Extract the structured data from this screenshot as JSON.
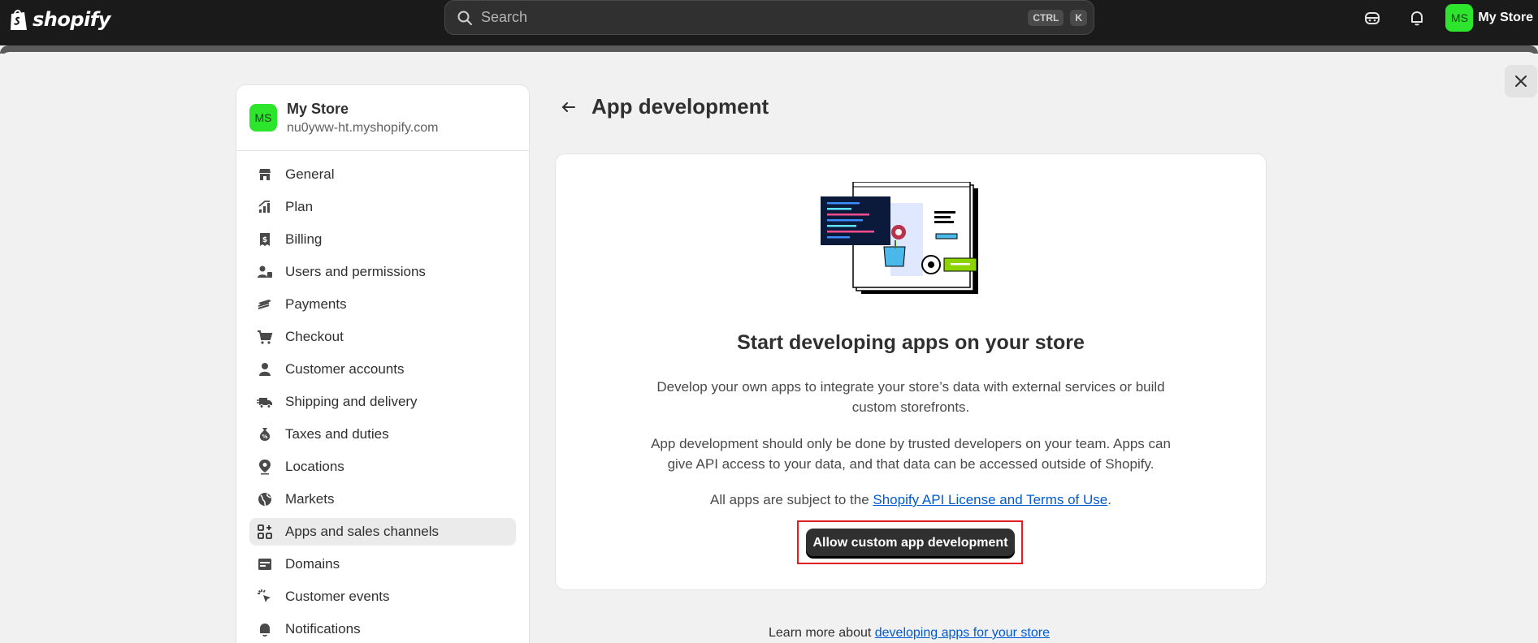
{
  "topbar": {
    "brand": "shopify",
    "search_placeholder": "Search",
    "shortcut_ctrl": "CTRL",
    "shortcut_key": "K",
    "store_initials": "MS",
    "store_name": "My Store"
  },
  "sidebar": {
    "store_initials": "MS",
    "store_name": "My Store",
    "store_domain": "nu0yww-ht.myshopify.com",
    "items": [
      {
        "label": "General",
        "icon": "store-icon",
        "active": false
      },
      {
        "label": "Plan",
        "icon": "plan-icon",
        "active": false
      },
      {
        "label": "Billing",
        "icon": "billing-icon",
        "active": false
      },
      {
        "label": "Users and permissions",
        "icon": "users-icon",
        "active": false
      },
      {
        "label": "Payments",
        "icon": "payments-icon",
        "active": false
      },
      {
        "label": "Checkout",
        "icon": "cart-icon",
        "active": false
      },
      {
        "label": "Customer accounts",
        "icon": "person-icon",
        "active": false
      },
      {
        "label": "Shipping and delivery",
        "icon": "truck-icon",
        "active": false
      },
      {
        "label": "Taxes and duties",
        "icon": "tax-icon",
        "active": false
      },
      {
        "label": "Locations",
        "icon": "location-icon",
        "active": false
      },
      {
        "label": "Markets",
        "icon": "globe-icon",
        "active": false
      },
      {
        "label": "Apps and sales channels",
        "icon": "apps-icon",
        "active": true
      },
      {
        "label": "Domains",
        "icon": "domains-icon",
        "active": false
      },
      {
        "label": "Customer events",
        "icon": "cursor-icon",
        "active": false
      },
      {
        "label": "Notifications",
        "icon": "bell-icon",
        "active": false
      }
    ]
  },
  "main": {
    "title": "App development",
    "card": {
      "heading": "Start developing apps on your store",
      "para1_line1": "Develop your own apps to integrate your store’s data with external services or build",
      "para1_line2": "custom storefronts.",
      "para2_line1": "App development should only be done by trusted developers on your team. Apps can",
      "para2_line2": "give API access to your data, and that data can be accessed outside of Shopify.",
      "para3_prefix": "All apps are subject to the ",
      "para3_link": "Shopify API License and Terms of Use",
      "para3_suffix": ".",
      "cta": "Allow custom app development"
    },
    "footer_prefix": "Learn more about ",
    "footer_link": "developing apps for your store"
  },
  "colors": {
    "topbar_bg": "#1a1a1a",
    "avatar_green": "#2ee52e",
    "link_blue": "#005bd3",
    "highlight_red": "#e02020",
    "cta_bg": "#303030"
  }
}
